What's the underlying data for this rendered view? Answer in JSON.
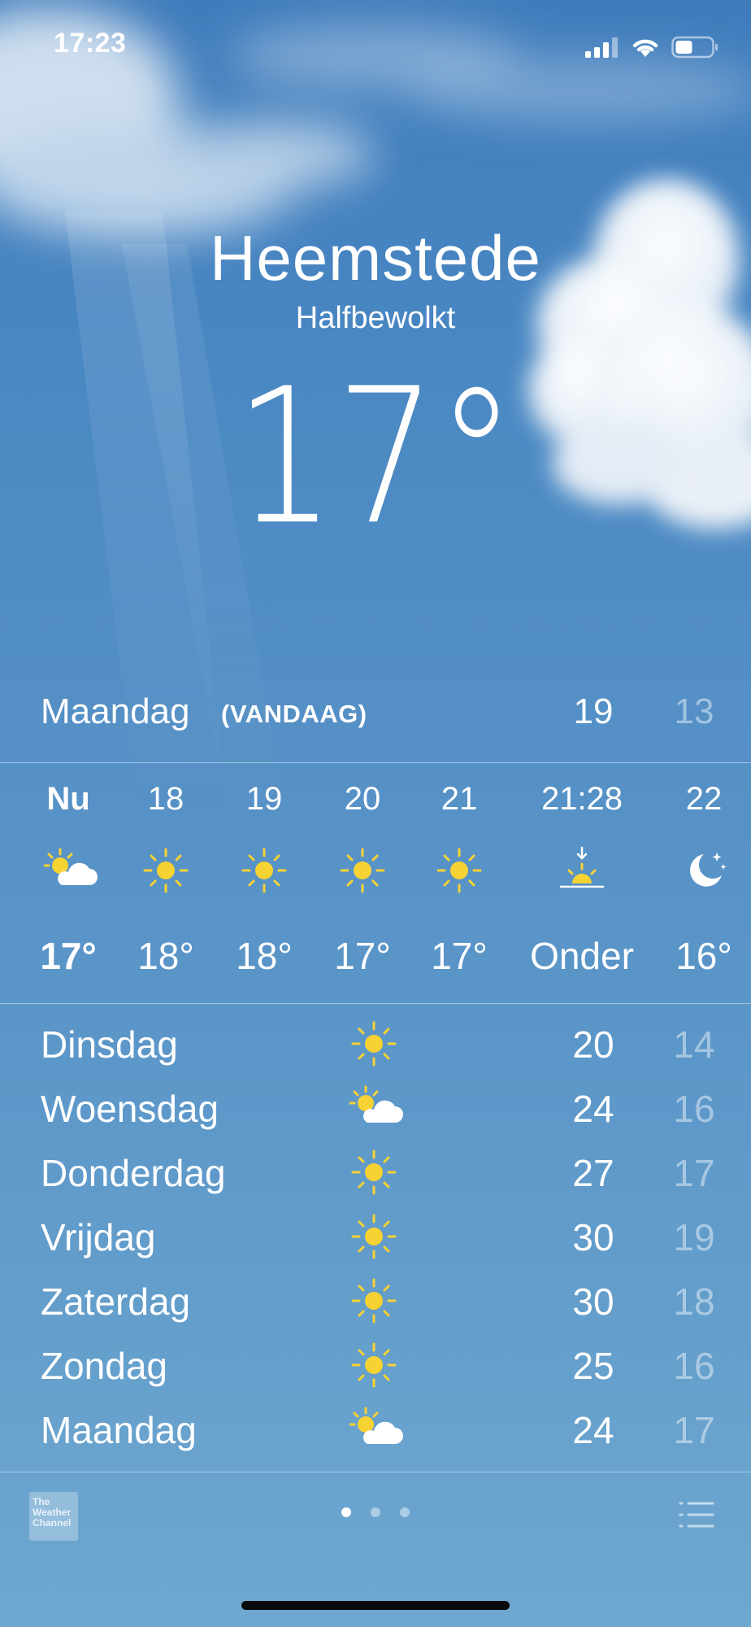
{
  "status_bar": {
    "time": "17:23"
  },
  "location": {
    "city": "Heemstede",
    "condition": "Halfbewolkt",
    "temperature": "17°"
  },
  "today": {
    "day": "Maandag",
    "tag": "(VANDAAG)",
    "high": "19",
    "low": "13"
  },
  "hourly": [
    {
      "time": "Nu",
      "icon": "partly-cloudy-icon",
      "temp": "17°"
    },
    {
      "time": "18",
      "icon": "sun-icon",
      "temp": "18°"
    },
    {
      "time": "19",
      "icon": "sun-icon",
      "temp": "18°"
    },
    {
      "time": "20",
      "icon": "sun-icon",
      "temp": "17°"
    },
    {
      "time": "21",
      "icon": "sun-icon",
      "temp": "17°"
    },
    {
      "time": "21:28",
      "icon": "sunset-icon",
      "temp": "Onder"
    },
    {
      "time": "22",
      "icon": "moon-icon",
      "temp": "16°"
    }
  ],
  "daily": [
    {
      "day": "Dinsdag",
      "icon": "sun-icon",
      "high": "20",
      "low": "14"
    },
    {
      "day": "Woensdag",
      "icon": "partly-cloudy-icon",
      "high": "24",
      "low": "16"
    },
    {
      "day": "Donderdag",
      "icon": "sun-icon",
      "high": "27",
      "low": "17"
    },
    {
      "day": "Vrijdag",
      "icon": "sun-icon",
      "high": "30",
      "low": "19"
    },
    {
      "day": "Zaterdag",
      "icon": "sun-icon",
      "high": "30",
      "low": "18"
    },
    {
      "day": "Zondag",
      "icon": "sun-icon",
      "high": "25",
      "low": "16"
    },
    {
      "day": "Maandag",
      "icon": "partly-cloudy-icon",
      "high": "24",
      "low": "17"
    }
  ],
  "footer": {
    "logo": {
      "line1": "The",
      "line2": "Weather",
      "line3": "Channel"
    },
    "pages": 3,
    "active_page": 0
  },
  "colors": {
    "sun": "#f7d233",
    "low_temp": "rgba(255,255,255,0.45)"
  }
}
